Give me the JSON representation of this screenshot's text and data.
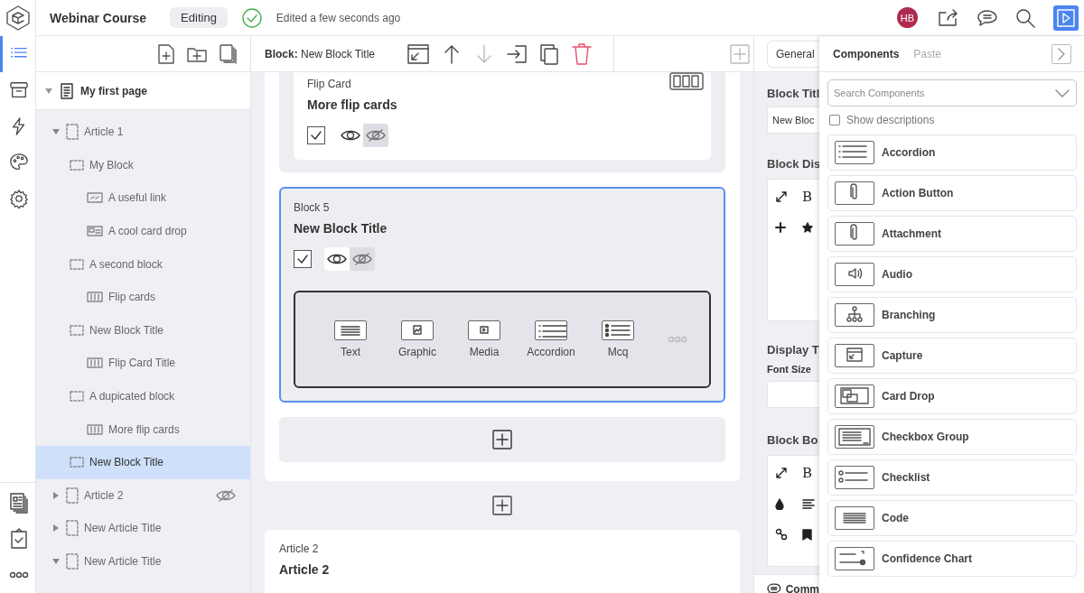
{
  "topbar": {
    "course_title": "Webinar Course",
    "mode": "Editing",
    "save_status": "Edited a few seconds ago",
    "avatar": "HB",
    "preview_selected": true
  },
  "rail": {
    "items": [
      {
        "kind": "outline",
        "selected": true
      },
      {
        "kind": "assets",
        "selected": false
      },
      {
        "kind": "triggers",
        "selected": false
      },
      {
        "kind": "theme",
        "selected": false
      },
      {
        "kind": "settings",
        "selected": false
      }
    ]
  },
  "tree": {
    "page": {
      "label": "My first page",
      "expanded": true
    },
    "articles": [
      {
        "label": "Article 1",
        "expanded": true,
        "hidden": false,
        "selected": false,
        "children": [
          {
            "kind": "block",
            "label": "My Block",
            "selected": false,
            "children": [
              {
                "kind": "link",
                "label": "A useful link",
                "selected": false
              },
              {
                "kind": "carddrop",
                "label": "A cool card drop",
                "selected": false
              }
            ]
          },
          {
            "kind": "block",
            "label": "A second block",
            "selected": false,
            "children": [
              {
                "kind": "flipcard",
                "label": "Flip cards",
                "selected": false
              }
            ]
          },
          {
            "kind": "block",
            "label": "New Block Title",
            "selected": false,
            "children": [
              {
                "kind": "flipcard",
                "label": "Flip Card Title",
                "selected": false
              }
            ]
          },
          {
            "kind": "block",
            "label": "A dupicated block",
            "selected": false,
            "children": [
              {
                "kind": "flipcard",
                "label": "More flip cards",
                "selected": false
              }
            ]
          },
          {
            "kind": "block",
            "label": "New Block Title",
            "selected": true
          }
        ]
      },
      {
        "label": "Article 2",
        "expanded": false,
        "hidden": true,
        "selected": false
      },
      {
        "label": "New Article Title",
        "expanded": false,
        "hidden": false,
        "selected": false
      },
      {
        "label": "New Article Title",
        "expanded": true,
        "hidden": false,
        "selected": false
      }
    ]
  },
  "canvas": {
    "toolbar": {
      "context": "**Block:** New Block Title",
      "move_down_disabled": true
    },
    "blocks": [
      {
        "label": "Flip Card",
        "title": "More flip cards",
        "checked": true,
        "visible": true,
        "selected": false
      },
      {
        "label": "Block 5",
        "title": "New Block Title",
        "checked": true,
        "visible": true,
        "selected": true,
        "picker": [
          {
            "kind": "text",
            "label": "Text"
          },
          {
            "kind": "graphic",
            "label": "Graphic"
          },
          {
            "kind": "media",
            "label": "Media"
          },
          {
            "kind": "accordion",
            "label": "Accordion"
          },
          {
            "kind": "mcq",
            "label": "Mcq"
          }
        ]
      }
    ],
    "next_article": {
      "label": "Article 2",
      "title": "Article 2"
    }
  },
  "properties": {
    "tab": "General",
    "block_title_label": "Block Titl",
    "block_title_value": "New Bloc",
    "display_label": "Block Dis",
    "display_title_label": "Display T",
    "font_size_label": "Font Size",
    "body_label": "Block Bo",
    "display_bold_key": "B",
    "body_bold_key": "B",
    "comments": "Comm"
  },
  "components": {
    "tabs": [
      {
        "label": "Components",
        "selected": true
      },
      {
        "label": "Paste",
        "selected": false
      }
    ],
    "search_placeholder": "Search Components",
    "show_descriptions": {
      "label": "Show descriptions",
      "checked": false
    },
    "items": [
      {
        "kind": "accordion",
        "label": "Accordion"
      },
      {
        "kind": "clip",
        "label": "Action Button"
      },
      {
        "kind": "clip",
        "label": "Attachment"
      },
      {
        "kind": "audio",
        "label": "Audio"
      },
      {
        "kind": "branching",
        "label": "Branching"
      },
      {
        "kind": "capture",
        "label": "Capture"
      },
      {
        "kind": "carddrop",
        "label": "Card Drop"
      },
      {
        "kind": "checkboxgroup",
        "label": "Checkbox Group"
      },
      {
        "kind": "checklist",
        "label": "Checklist"
      },
      {
        "kind": "code",
        "label": "Code"
      },
      {
        "kind": "confidence",
        "label": "Confidence Chart"
      }
    ]
  }
}
